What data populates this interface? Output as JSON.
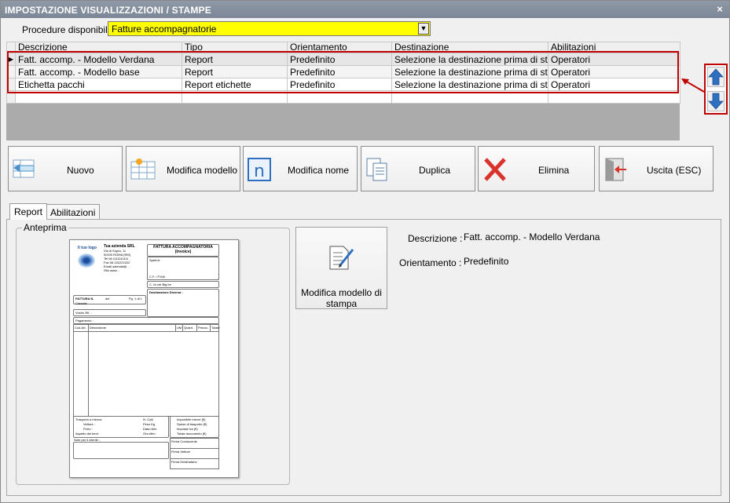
{
  "window": {
    "title": "IMPOSTAZIONE VISUALIZZAZIONI / STAMPE",
    "close_glyph": "×"
  },
  "procedure": {
    "label": "Procedure disponibili :",
    "value": "Fatture accompagnatorie"
  },
  "grid": {
    "columns": [
      "Descrizione",
      "Tipo",
      "Orientamento",
      "Destinazione",
      "Abilitazioni"
    ],
    "rows": [
      {
        "descrizione": "Fatt. accomp. - Modello Verdana",
        "tipo": "Report",
        "orientamento": "Predefinito",
        "destinazione": "Selezione la destinazione prima di sta...",
        "abilitazioni": "Operatori"
      },
      {
        "descrizione": "Fatt. accomp. - Modello base",
        "tipo": "Report",
        "orientamento": "Predefinito",
        "destinazione": "Selezione la destinazione prima di sta...",
        "abilitazioni": "Operatori"
      },
      {
        "descrizione": "Etichetta pacchi",
        "tipo": "Report etichette",
        "orientamento": "Predefinito",
        "destinazione": "Selezione la destinazione prima di sta...",
        "abilitazioni": "Operatori"
      }
    ]
  },
  "toolbar": {
    "nuovo": "Nuovo",
    "modifica_modello": "Modifica modello",
    "modifica_nome": "Modifica nome",
    "duplica": "Duplica",
    "elimina": "Elimina",
    "uscita": "Uscita (ESC)"
  },
  "tabs": {
    "report": "Report",
    "abilitazioni": "Abilitazioni"
  },
  "anteprima": {
    "legend": "Anteprima",
    "doc": {
      "logo": "Il tuo logo",
      "company": "Tua azienda SRL",
      "address": [
        "Via di Sopra, 11",
        "00100 ROMA (RM)",
        "Tel 06 1111111111",
        "Fax 06 222222222",
        "Email azienda@...",
        "Sito www..."
      ],
      "doc_title": "FATTURA ACCOMPAGNATORIA",
      "doc_subtitle": "(Invoice)",
      "spett": "Spett.le",
      "cf_piva": "C.F. / P.IVA",
      "codice": "C. Id.ore Big.Ire",
      "destinazione": "Destinazione Diversa :",
      "fattura_n": "FATTURA N.",
      "del": "del",
      "pag": "Pg.  1 di 1",
      "causale": "Causale",
      "vostro": "Vostro Rif. :",
      "pagamento": "Pagamento :",
      "col_codice": "Cod.Art.",
      "col_descr": "Descrizione",
      "col_um": "UM",
      "col_quant": "Quant.",
      "col_prezzo": "Prezzo",
      "col_totale": "Totale",
      "foot_left": [
        "Trasporto a mezzo:",
        "Vettore :",
        "Porto :",
        "Aspetto dei beni:"
      ],
      "foot_mid": [
        "N. Colli",
        "Peso Kg.",
        "Data ritiro",
        "Ora ritiro"
      ],
      "foot_right": [
        "Imponibile merce (€)",
        "Spese di trasporto (€)",
        "Imposta Iva (€)",
        "Totale documento (€)"
      ],
      "note": "Note per il cliente :",
      "firme": [
        "Firma Conducente",
        "Firma Vettore",
        "Firma Destinatario"
      ]
    }
  },
  "edit_button": {
    "line1": "Modifica modello di",
    "line2": "stampa"
  },
  "details": {
    "descrizione_label": "Descrizione :",
    "descrizione_value": "Fatt. accomp. - Modello Verdana",
    "orientamento_label": "Orientamento :",
    "orientamento_value": "Predefinito"
  },
  "colors": {
    "highlight_red": "#c00000",
    "procedure_bg": "#ffff00",
    "arrow_blue": "#2f6fc1"
  }
}
